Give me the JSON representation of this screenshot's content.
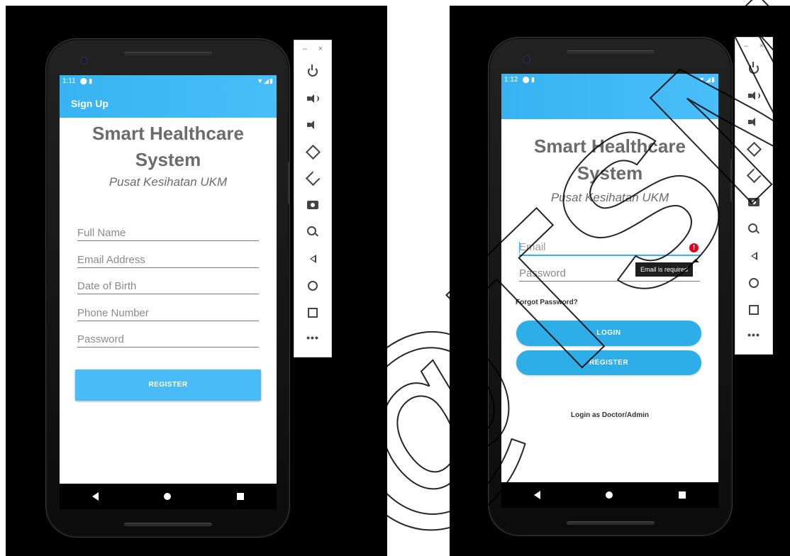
{
  "left_phone": {
    "status": {
      "time": "1:11",
      "icons": "⬤ ▮",
      "signal": "▼◢▮"
    },
    "appbar_title": "Sign Up",
    "app_title_line1": "Smart Healthcare",
    "app_title_line2": "System",
    "subtitle": "Pusat Kesihatan UKM",
    "fields": [
      "Full Name",
      "Email Address",
      "Date of Birth",
      "Phone Number",
      "Password"
    ],
    "register_label": "REGISTER"
  },
  "right_phone": {
    "status": {
      "time": "1:12",
      "icons": "⬤ ▮",
      "signal": "▼◢▮"
    },
    "app_title_line1": "Smart Healthcare",
    "app_title_line2": "System",
    "subtitle": "Pusat Kesihatan UKM",
    "email_placeholder": "Email",
    "password_placeholder": "Password",
    "error_tooltip": "Email is required",
    "forgot_password": "Forgot Password?",
    "login_label": "LOGIN",
    "register_label": "REGISTER",
    "doctor_admin_link": "Login as Doctor/Admin"
  },
  "emulator_toolbar": {
    "minimize": "–",
    "close": "×",
    "more": "•••"
  },
  "watermark_text": "@TSM",
  "colors": {
    "accent": "#38b3f1",
    "button": "#2eaee6",
    "error": "#e3001b"
  }
}
